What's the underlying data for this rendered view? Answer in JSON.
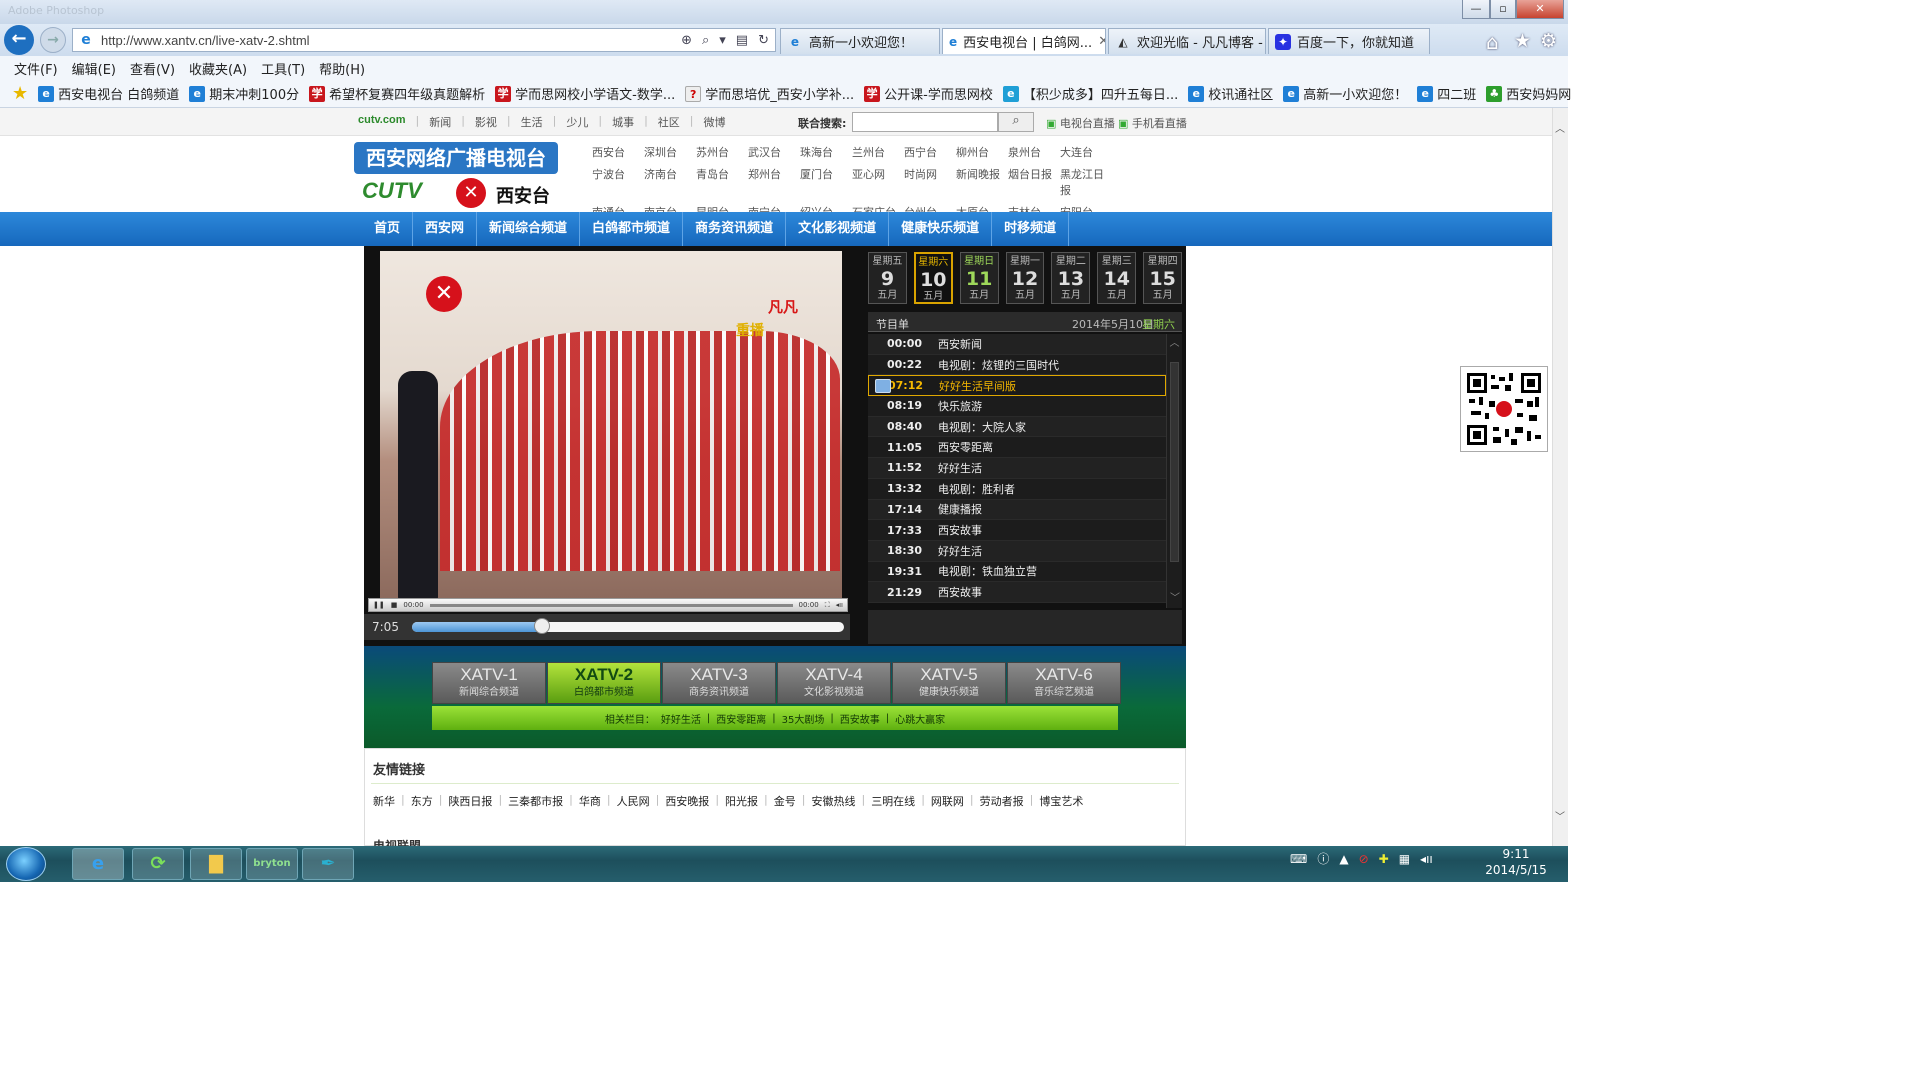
{
  "browser": {
    "title_faint": "Adobe Photoshop",
    "address": "http://www.xantv.cn/live-xatv-2.shtml",
    "tabs": [
      {
        "label": "高新一小欢迎您！"
      },
      {
        "label": "西安电视台 | 白鸽网...",
        "active": true
      },
      {
        "label": "欢迎光临 - 凡凡博客 -"
      },
      {
        "label": "百度一下，你就知道"
      }
    ],
    "menu": [
      "文件(F)",
      "编辑(E)",
      "查看(V)",
      "收藏夹(A)",
      "工具(T)",
      "帮助(H)"
    ],
    "favorites": [
      "西安电视台 白鸽频道",
      "期末冲刺100分",
      "希望杯复赛四年级真题解析",
      "学而思网校小学语文-数学...",
      "学而思培优_西安小学补...",
      "公开课-学而思网校",
      "【积少成多】四升五每日...",
      "校讯通社区",
      "高新一小欢迎您！",
      "四二班",
      "西安妈妈网"
    ],
    "window_buttons": [
      "—",
      "▫",
      "✕"
    ]
  },
  "site": {
    "topnav": {
      "brand": "cutv.com",
      "links": [
        "新闻",
        "影视",
        "生活",
        "少儿",
        "城事",
        "社区",
        "微博"
      ],
      "search_label": "联合搜索:",
      "search_value": "",
      "live_links": [
        "电视台直播",
        "手机看直播"
      ]
    },
    "logo": {
      "line1": "西安网络广播电视台",
      "cutv": "CUTV",
      "station": "西安台",
      "mark": "✕"
    },
    "stations": [
      "西安台",
      "深圳台",
      "苏州台",
      "武汉台",
      "珠海台",
      "兰州台",
      "西宁台",
      "柳州台",
      "泉州台",
      "大连台",
      "宁波台",
      "济南台",
      "青岛台",
      "郑州台",
      "厦门台",
      "亚心网",
      "时尚网",
      "新闻晚报",
      "烟台日报",
      "黑龙江日报",
      "南通台",
      "南京台",
      "昆明台",
      "南宁台",
      "绍兴台",
      "石家庄台",
      "台州台",
      "太原台",
      "吉林台",
      "安阳台"
    ],
    "mainnav": [
      "首页",
      "西安网",
      "新闻综合频道",
      "白鸽都市频道",
      "商务资讯频道",
      "文化影视频道",
      "健康快乐频道",
      "时移频道"
    ]
  },
  "player": {
    "overlay_text1": "凡凡",
    "overlay_text2": "重播",
    "ctrl_time_left": "00:00",
    "ctrl_time_right": "00:00",
    "seek_time": "7:05",
    "seek_progress": 0.3
  },
  "epg": {
    "days": [
      {
        "weekday": "星期五",
        "day": "9",
        "month": "五月"
      },
      {
        "weekday": "星期六",
        "day": "10",
        "month": "五月",
        "selected": true
      },
      {
        "weekday": "星期日",
        "day": "11",
        "month": "五月",
        "sunday": true
      },
      {
        "weekday": "星期一",
        "day": "12",
        "month": "五月"
      },
      {
        "weekday": "星期二",
        "day": "13",
        "month": "五月"
      },
      {
        "weekday": "星期三",
        "day": "14",
        "month": "五月"
      },
      {
        "weekday": "星期四",
        "day": "15",
        "month": "五月"
      }
    ],
    "header_title": "节目单",
    "header_date": "2014年5月10日",
    "header_weekday": "星期六",
    "programs": [
      {
        "time": "00:00",
        "title": "西安新闻"
      },
      {
        "time": "00:22",
        "title": "电视剧：炫锂的三国时代"
      },
      {
        "time": "07:12",
        "title": "好好生活早间版",
        "current": true
      },
      {
        "time": "08:19",
        "title": "快乐旅游"
      },
      {
        "time": "08:40",
        "title": "电视剧：大院人家"
      },
      {
        "time": "11:05",
        "title": "西安零距离"
      },
      {
        "time": "11:52",
        "title": "好好生活"
      },
      {
        "time": "13:32",
        "title": "电视剧：胜利者"
      },
      {
        "time": "17:14",
        "title": "健康播报"
      },
      {
        "time": "17:33",
        "title": "西安故事"
      },
      {
        "time": "18:30",
        "title": "好好生活"
      },
      {
        "time": "19:31",
        "title": "电视剧：铁血独立营"
      },
      {
        "time": "21:29",
        "title": "西安故事"
      }
    ]
  },
  "channels": [
    {
      "code": "XATV-1",
      "name": "新闻综合频道"
    },
    {
      "code": "XATV-2",
      "name": "白鸽都市频道",
      "selected": true
    },
    {
      "code": "XATV-3",
      "name": "商务资讯频道"
    },
    {
      "code": "XATV-4",
      "name": "文化影视频道"
    },
    {
      "code": "XATV-5",
      "name": "健康快乐频道"
    },
    {
      "code": "XATV-6",
      "name": "音乐综艺频道"
    }
  ],
  "related": {
    "label": "相关栏目：",
    "items": [
      "好好生活",
      "西安零距离",
      "35大剧场",
      "西安故事",
      "心跳大赢家"
    ]
  },
  "friends": {
    "title": "友情链接",
    "links": [
      "新华",
      "东方",
      "陕西日报",
      "三秦都市报",
      "华商",
      "人民网",
      "西安晚报",
      "阳光报",
      "金号",
      "安徽热线",
      "三明在线",
      "网联网",
      "劳动者报",
      "博宝艺术"
    ],
    "next_title": "电视联盟"
  },
  "taskbar": {
    "time": "9:11",
    "date": "2014/5/15"
  }
}
